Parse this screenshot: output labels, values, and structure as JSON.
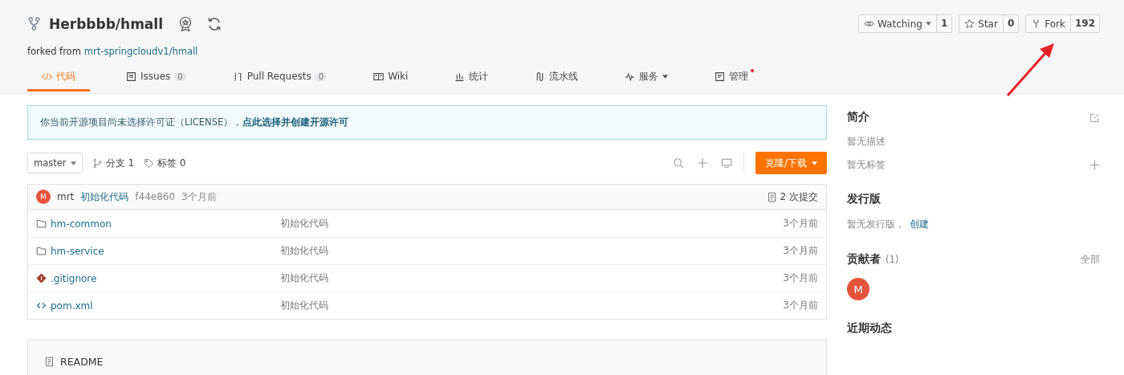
{
  "repo": {
    "title": "Herbbbb/hmall",
    "forked_from_label": "forked from",
    "forked_from": "mrt-springcloudv1/hmall"
  },
  "actions": [
    {
      "label": "Watching",
      "count": "1",
      "menu": true
    },
    {
      "label": "Star",
      "count": "0",
      "menu": false
    },
    {
      "label": "Fork",
      "count": "192",
      "menu": false
    }
  ],
  "tabs": [
    {
      "label": "代码",
      "menu": false,
      "notice": false,
      "selected": true
    },
    {
      "label": "Issues",
      "count": "0",
      "menu": false,
      "notice": false,
      "selected": false
    },
    {
      "label": "Pull Requests",
      "count": "0",
      "menu": false,
      "notice": false,
      "selected": false
    },
    {
      "label": "Wiki",
      "menu": false,
      "notice": false,
      "selected": false
    },
    {
      "label": "统计",
      "menu": false,
      "notice": false,
      "selected": false
    },
    {
      "label": "流水线",
      "menu": false,
      "notice": false,
      "selected": false
    },
    {
      "label": "服务",
      "menu": true,
      "notice": false,
      "selected": false
    },
    {
      "label": "管理",
      "menu": false,
      "notice": true,
      "selected": false
    }
  ],
  "license_notice": {
    "text": "你当前开源项目尚未选择许可证（LICENSE），",
    "link": "点此选择并创建开源许可"
  },
  "toolbar": {
    "branch": "master",
    "branches": "分支 1",
    "tags": "标签 0",
    "clone_button": "克隆/下载"
  },
  "commit": {
    "avatar": "M",
    "author": "mrt",
    "message": "初始化代码",
    "hash": "f44e860",
    "time": "3个月前",
    "commits": "2 次提交"
  },
  "files": [
    {
      "kind": "folder",
      "name": "hm-common",
      "message": "初始化代码",
      "time": "3个月前"
    },
    {
      "kind": "folder",
      "name": "hm-service",
      "message": "初始化代码",
      "time": "3个月前"
    },
    {
      "kind": "git",
      "name": ".gitignore",
      "message": "初始化代码",
      "time": "3个月前"
    },
    {
      "kind": "code",
      "name": "pom.xml",
      "message": "初始化代码",
      "time": "3个月前"
    }
  ],
  "readme": {
    "tab": "README"
  },
  "sidebar": {
    "intro_title": "简介",
    "description": "暂无描述",
    "tags": "暂无标签",
    "releases_title": "发行版",
    "no_releases": "暂无发行版，",
    "create_link": "创建",
    "contributors_title": "贡献者",
    "contributors_count": "(1)",
    "all_link": "全部",
    "contributors": [
      {
        "initial": "M",
        "color": "#e5533d"
      }
    ],
    "activity_title": "近期动态"
  }
}
